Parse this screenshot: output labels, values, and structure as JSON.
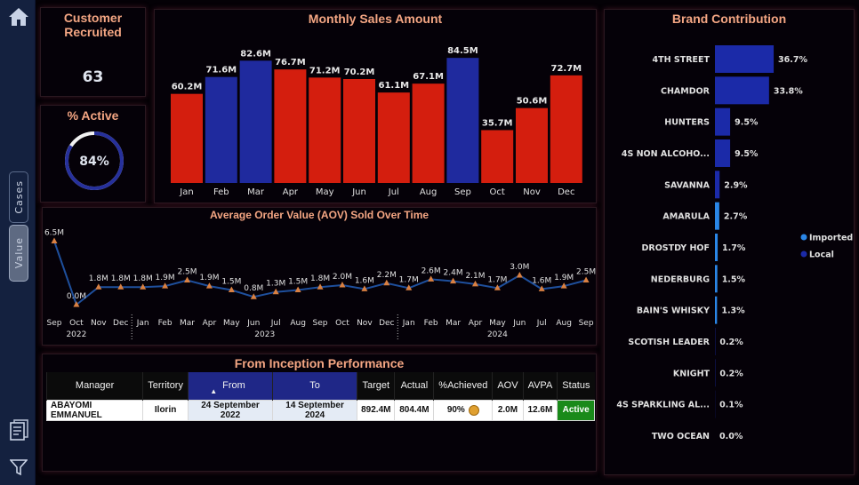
{
  "nav": {
    "home_icon": "home-icon",
    "toggle_cases": "Cases",
    "toggle_value": "Value",
    "doc_icon": "document-icon",
    "filter_icon": "filter-icon"
  },
  "kpi_recruited": {
    "title": "Customer Recruited",
    "value": "63"
  },
  "kpi_active": {
    "title": "% Active",
    "value": "84%",
    "fraction": 0.84,
    "accent": "#26309b"
  },
  "chart_data": [
    {
      "id": "monthly",
      "type": "bar",
      "title": "Monthly Sales Amount",
      "categories": [
        "Jan",
        "Feb",
        "Mar",
        "Apr",
        "May",
        "Jun",
        "Jul",
        "Aug",
        "Sep",
        "Oct",
        "Nov",
        "Dec"
      ],
      "values": [
        60.2,
        71.6,
        82.6,
        76.7,
        71.2,
        70.2,
        61.1,
        67.1,
        84.5,
        35.7,
        50.6,
        72.7
      ],
      "labels": [
        "60.2M",
        "71.6M",
        "82.6M",
        "76.7M",
        "71.2M",
        "70.2M",
        "61.1M",
        "67.1M",
        "84.5M",
        "35.7M",
        "50.6M",
        "72.7M"
      ],
      "highlight": [
        false,
        true,
        true,
        false,
        false,
        false,
        false,
        false,
        true,
        false,
        false,
        false
      ],
      "colors": {
        "normal": "#d41e0e",
        "highlight": "#1f2a9e"
      },
      "ylim": [
        0,
        90
      ]
    },
    {
      "id": "aov",
      "type": "line",
      "title": "Average Order Value (AOV) Sold Over Time",
      "x": [
        "Sep",
        "Oct",
        "Nov",
        "Dec",
        "Jan",
        "Feb",
        "Mar",
        "Apr",
        "May",
        "Jun",
        "Jul",
        "Aug",
        "Sep",
        "Oct",
        "Nov",
        "Dec",
        "Jan",
        "Feb",
        "Mar",
        "Apr",
        "May",
        "Jun",
        "Jul",
        "Aug",
        "Sep"
      ],
      "values": [
        6.5,
        0.0,
        1.8,
        1.8,
        1.8,
        1.9,
        2.5,
        1.9,
        1.5,
        0.8,
        1.3,
        1.5,
        1.8,
        2.0,
        1.6,
        2.2,
        1.7,
        2.6,
        2.4,
        2.1,
        1.7,
        3.0,
        1.6,
        1.9,
        2.5
      ],
      "labels": [
        "6.5M",
        "0.0M",
        "1.8M",
        "1.8M",
        "1.8M",
        "1.9M",
        "2.5M",
        "1.9M",
        "1.5M",
        "0.8M",
        "1.3M",
        "1.5M",
        "1.8M",
        "2.0M",
        "1.6M",
        "2.2M",
        "1.7M",
        "2.6M",
        "2.4M",
        "2.1M",
        "1.7M",
        "3.0M",
        "1.6M",
        "1.9M",
        "2.5M"
      ],
      "years": [
        {
          "label": "2022",
          "at": 1
        },
        {
          "label": "2023",
          "at": 9.5
        },
        {
          "label": "2024",
          "at": 20
        }
      ],
      "year_separators": [
        3.5,
        15.5
      ],
      "colors": {
        "line": "#1e4f9c",
        "marker": "#d98042"
      },
      "ylim": [
        0,
        7
      ]
    },
    {
      "id": "brands",
      "type": "bar",
      "title": "Brand Contribution",
      "categories": [
        "4TH STREET",
        "CHAMDOR",
        "HUNTERS",
        "4S NON ALCOHO...",
        "SAVANNA",
        "AMARULA",
        "DROSTDY HOF",
        "NEDERBURG",
        "BAIN'S WHISKY",
        "SCOTISH LEADER",
        "KNIGHT",
        "4S SPARKLING AL...",
        "TWO OCEAN"
      ],
      "values": [
        36.7,
        33.8,
        9.5,
        9.5,
        2.9,
        2.7,
        1.7,
        1.5,
        1.3,
        0.2,
        0.2,
        0.1,
        0.0
      ],
      "labels": [
        "36.7%",
        "33.8%",
        "9.5%",
        "9.5%",
        "2.9%",
        "2.7%",
        "1.7%",
        "1.5%",
        "1.3%",
        "0.2%",
        "0.2%",
        "0.1%",
        "0.0%"
      ],
      "group": [
        "Local",
        "Local",
        "Local",
        "Local",
        "Local",
        "Imported",
        "Imported",
        "Imported",
        "Imported",
        "Local",
        "Local",
        "Local",
        "Local"
      ],
      "legend": [
        {
          "name": "Imported",
          "color": "#2a86e6"
        },
        {
          "name": "Local",
          "color": "#1b2aa8"
        }
      ],
      "legend_position": "right"
    }
  ],
  "inception": {
    "title": "From Inception Performance",
    "headers": {
      "manager": "Manager",
      "territory": "Territory",
      "from": "From",
      "to": "To",
      "target": "Target",
      "actual": "Actual",
      "achieved": "%Achieved",
      "aov": "AOV",
      "avpa": "AVPA",
      "status": "Status"
    },
    "row": {
      "manager": "ABAYOMI EMMANUEL",
      "territory": "Ilorin",
      "from": "24 September 2022",
      "to": "14 September 2024",
      "target": "892.4M",
      "actual": "804.4M",
      "achieved": "90%",
      "aov": "2.0M",
      "avpa": "12.6M",
      "status": "Active"
    }
  }
}
